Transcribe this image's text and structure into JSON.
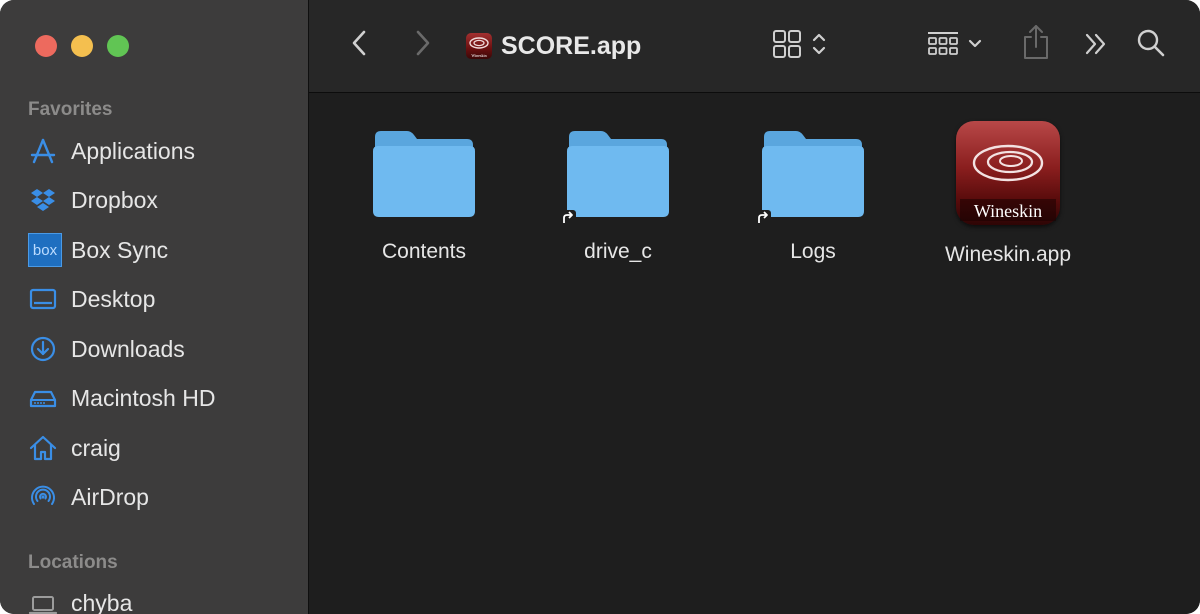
{
  "window": {
    "title": "SCORE.app",
    "title_icon_text": "Wineskin"
  },
  "sidebar": {
    "favorites_title": "Favorites",
    "favorites": [
      {
        "label": "Applications",
        "icon": "applications-icon"
      },
      {
        "label": "Dropbox",
        "icon": "dropbox-icon"
      },
      {
        "label": "Box Sync",
        "icon": "box-icon",
        "icon_text": "box"
      },
      {
        "label": "Desktop",
        "icon": "desktop-icon"
      },
      {
        "label": "Downloads",
        "icon": "downloads-icon"
      },
      {
        "label": "Macintosh HD",
        "icon": "hard-drive-icon"
      },
      {
        "label": "craig",
        "icon": "home-icon"
      },
      {
        "label": "AirDrop",
        "icon": "airdrop-icon"
      }
    ],
    "locations_title": "Locations",
    "locations": [
      {
        "label": "chyba",
        "icon": "laptop-icon"
      }
    ]
  },
  "content": {
    "items": [
      {
        "label": "Contents",
        "type": "folder",
        "alias": false
      },
      {
        "label": "drive_c",
        "type": "folder",
        "alias": true
      },
      {
        "label": "Logs",
        "type": "folder",
        "alias": true
      },
      {
        "label": "Wineskin.app",
        "type": "app",
        "icon_text": "Wineskin"
      }
    ]
  },
  "colors": {
    "accent": "#3a8ee6",
    "folder": "#6fbaf0",
    "folder_tab": "#5aa6de"
  }
}
